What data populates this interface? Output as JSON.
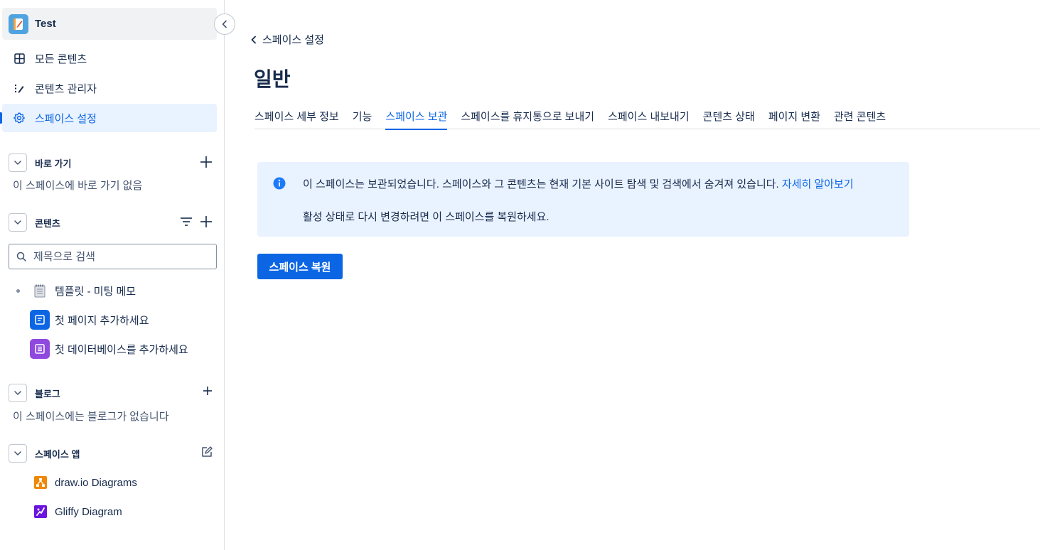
{
  "sidebar": {
    "space_name": "Test",
    "nav": [
      {
        "label": "모든 콘텐츠",
        "icon": "grid-icon"
      },
      {
        "label": "콘텐츠 관리자",
        "icon": "content-manager-icon"
      },
      {
        "label": "스페이스 설정",
        "icon": "gear-icon",
        "active": true
      }
    ],
    "shortcuts": {
      "title": "바로 가기",
      "empty": "이 스페이스에 바로 가기 없음"
    },
    "content": {
      "title": "콘텐츠",
      "search_placeholder": "제목으로 검색",
      "items": [
        {
          "label": "템플릿 - 미팅 메모",
          "icon": "notepad-icon"
        },
        {
          "label": "첫 페이지 추가하세요",
          "icon": "page-icon"
        },
        {
          "label": "첫 데이터베이스를 추가하세요",
          "icon": "database-icon"
        }
      ]
    },
    "blog": {
      "title": "블로그",
      "empty": "이 스페이스에는 블로그가 없습니다"
    },
    "apps": {
      "title": "스페이스 앱",
      "items": [
        {
          "label": "draw.io Diagrams",
          "icon": "drawio-icon"
        },
        {
          "label": "Gliffy Diagram",
          "icon": "gliffy-icon"
        }
      ]
    }
  },
  "main": {
    "back_label": "스페이스 설정",
    "title": "일반",
    "tabs": [
      {
        "label": "스페이스 세부 정보"
      },
      {
        "label": "기능"
      },
      {
        "label": "스페이스 보관",
        "active": true
      },
      {
        "label": "스페이스를 휴지통으로 보내기"
      },
      {
        "label": "스페이스 내보내기"
      },
      {
        "label": "콘텐츠 상태"
      },
      {
        "label": "페이지 변환"
      },
      {
        "label": "관련 콘텐츠"
      }
    ],
    "info": {
      "message": "이 스페이스는 보관되었습니다. 스페이스와 그 콘텐츠는 현재 기본 사이트 탐색 및 검색에서 숨겨져 있습니다. ",
      "link": "자세히 알아보기",
      "message2": "활성 상태로 다시 변경하려면 이 스페이스를 복원하세요."
    },
    "restore_button": "스페이스 복원"
  },
  "colors": {
    "accent": "#0c66e4",
    "info_bg": "#e9f2ff",
    "active_nav_bg": "#e9f2ff",
    "text": "#172b4d"
  }
}
